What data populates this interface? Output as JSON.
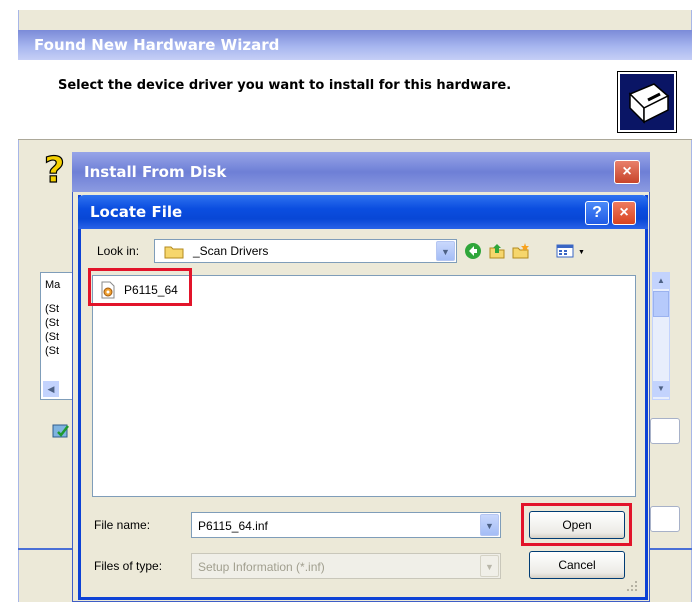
{
  "wizard": {
    "title": "Found New Hardware Wizard",
    "header_text": "Select the device driver you want to install for this hardware.",
    "list_header": "Ma",
    "list_rows": [
      "(St",
      "(St",
      "(St",
      "(St"
    ]
  },
  "install_from_disk": {
    "title": "Install From Disk",
    "close_label": "×"
  },
  "locate_file": {
    "title": "Locate File",
    "help_label": "?",
    "close_label": "×",
    "look_in": {
      "label": "Look in:",
      "value": "_Scan Drivers"
    },
    "files": [
      {
        "name": "P6115_64"
      }
    ],
    "file_name": {
      "label": "File name:",
      "value": "P6115_64.inf"
    },
    "file_type": {
      "label": "Files of type:",
      "value": "Setup Information (*.inf)"
    },
    "buttons": {
      "open": "Open",
      "cancel": "Cancel"
    }
  },
  "icons": [
    "question-mark-icon",
    "hardware-icon",
    "folder-icon",
    "back-icon",
    "up-folder-icon",
    "new-folder-icon",
    "view-menu-icon",
    "setup-file-icon",
    "disk-icon"
  ],
  "colors": {
    "xp_blue": "#0b4ee0",
    "highlight_red": "#e2142a",
    "dialog_bg": "#ece9d8"
  }
}
